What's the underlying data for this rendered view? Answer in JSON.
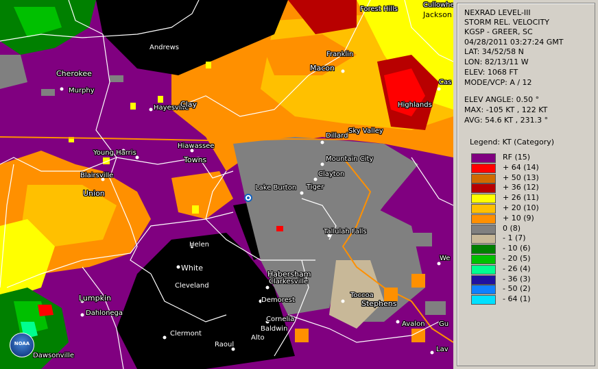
{
  "info": {
    "product": "NEXRAD LEVEL-III",
    "type": "STORM REL. VELOCITY",
    "radar": "KGSP - GREER, SC",
    "datetime": "04/28/2011 03:27:24 GMT",
    "lat": "LAT: 34/52/58 N",
    "lon": "LON: 82/13/11 W",
    "elev": "ELEV: 1068 FT",
    "mode": "MODE/VCP: A / 12",
    "elev_angle": "ELEV ANGLE: 0.50 °",
    "max": "MAX: -105 KT , 122 KT",
    "avg": "AVG: 54.6 KT , 231.3 °"
  },
  "legend": {
    "title": "Legend: KT (Category)",
    "items": [
      {
        "label": "RF  (15)",
        "color": "#800080"
      },
      {
        "label": "+ 64  (14)",
        "color": "#ff0000"
      },
      {
        "label": "+ 50  (13)",
        "color": "#d06a00"
      },
      {
        "label": "+ 36  (12)",
        "color": "#b80000"
      },
      {
        "label": "+ 26  (11)",
        "color": "#ffff00"
      },
      {
        "label": "+ 20  (10)",
        "color": "#ffc000"
      },
      {
        "label": "+ 10  (9)",
        "color": "#ff9000"
      },
      {
        "label": "0  (8)",
        "color": "#808080"
      },
      {
        "label": "- 1  (7)",
        "color": "#c8b898"
      },
      {
        "label": "- 10  (6)",
        "color": "#008000"
      },
      {
        "label": "- 20  (5)",
        "color": "#00c000"
      },
      {
        "label": "- 26  (4)",
        "color": "#00ff90"
      },
      {
        "label": "- 36  (3)",
        "color": "#2010a0"
      },
      {
        "label": "- 50  (2)",
        "color": "#1080ff"
      },
      {
        "label": "- 64  (1)",
        "color": "#00e0ff"
      }
    ]
  },
  "map": {
    "towns": [
      {
        "name": "Forest Hills"
      },
      {
        "name": "Cullowhee"
      },
      {
        "name": "Jackson"
      },
      {
        "name": "Andrews"
      },
      {
        "name": "Franklin"
      },
      {
        "name": "Cherokee"
      },
      {
        "name": "Macon"
      },
      {
        "name": "Cas"
      },
      {
        "name": "Murphy"
      },
      {
        "name": "Highlands"
      },
      {
        "name": "Hayesville"
      },
      {
        "name": "Clay"
      },
      {
        "name": "Sky Valley"
      },
      {
        "name": "Dillard"
      },
      {
        "name": "Young Harris"
      },
      {
        "name": "Hiawassee"
      },
      {
        "name": "Towns"
      },
      {
        "name": "Mountain City"
      },
      {
        "name": "Blairsville"
      },
      {
        "name": "Clayton"
      },
      {
        "name": "Lake Burton"
      },
      {
        "name": "Tiger"
      },
      {
        "name": "Union"
      },
      {
        "name": "Tallulah Falls"
      },
      {
        "name": "Helen"
      },
      {
        "name": "We"
      },
      {
        "name": "White"
      },
      {
        "name": "Habersham"
      },
      {
        "name": "Clarkesville"
      },
      {
        "name": "Cleveland"
      },
      {
        "name": "Toccoa"
      },
      {
        "name": "Lumpkin"
      },
      {
        "name": "Stephens"
      },
      {
        "name": "Demorest"
      },
      {
        "name": "Dahlonega"
      },
      {
        "name": "Cornelia"
      },
      {
        "name": "Avalon"
      },
      {
        "name": "Gu"
      },
      {
        "name": "Baldwin"
      },
      {
        "name": "Clermont"
      },
      {
        "name": "Alto"
      },
      {
        "name": "Raoul"
      },
      {
        "name": "Dawsonville"
      },
      {
        "name": "Lav"
      }
    ],
    "logo_text": "NOAA"
  }
}
